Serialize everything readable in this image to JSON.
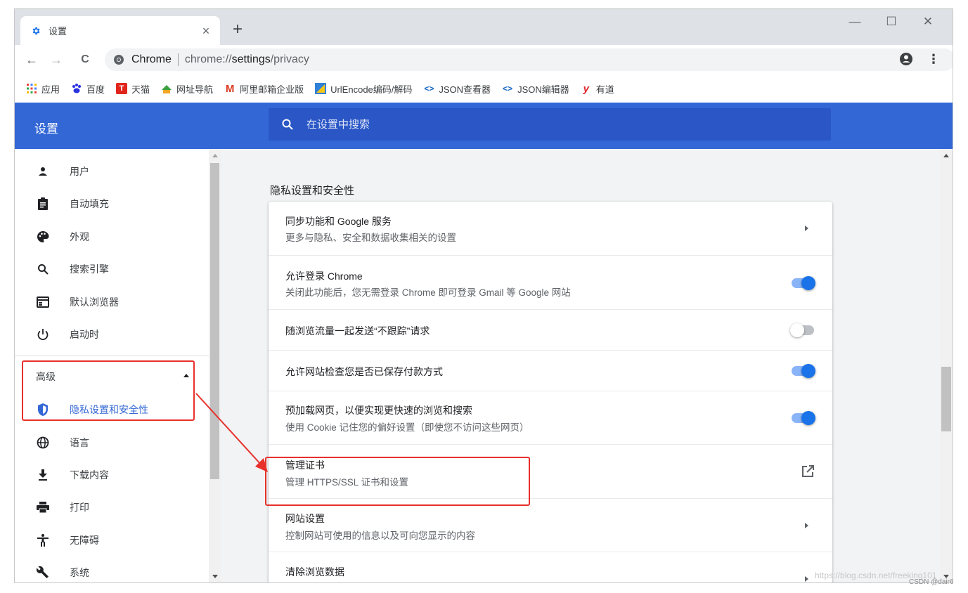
{
  "tab": {
    "icon": "gear-icon",
    "title": "设置",
    "close": "×"
  },
  "new_tab": "+",
  "window_controls": {
    "minimize": "—",
    "maximize": "☐",
    "close": "✕"
  },
  "toolbar": {
    "back": "←",
    "forward": "→",
    "reload": "C",
    "star": "☆",
    "menu": "⋮"
  },
  "omnibox": {
    "site_name": "Chrome",
    "url_prefix": "chrome://",
    "url_host": "settings",
    "url_path": "/privacy"
  },
  "bookmarks": [
    {
      "label": "应用",
      "icon": "apps-grid-icon",
      "color": "#1a73e8"
    },
    {
      "label": "百度",
      "icon": "baidu-paw-icon",
      "color": "#2932e1"
    },
    {
      "label": "天猫",
      "icon": "tmall-icon",
      "color": "#e1251b"
    },
    {
      "label": "网址导航",
      "icon": "hao123-icon",
      "color": "#3ba13f"
    },
    {
      "label": "阿里邮箱企业版",
      "icon": "ali-mail-icon",
      "color": "#d9381e"
    },
    {
      "label": "UrlEncode编码/解码",
      "icon": "urlencode-icon",
      "color": "#2f80d8"
    },
    {
      "label": "JSON查看器",
      "icon": "code-icon",
      "color": "#1565c0"
    },
    {
      "label": "JSON编辑器",
      "icon": "code-icon",
      "color": "#1565c0"
    },
    {
      "label": "有道",
      "icon": "youdao-icon",
      "color": "#e0272f"
    }
  ],
  "header": {
    "title": "设置",
    "search_placeholder": "在设置中搜索"
  },
  "sidebar": {
    "items": [
      {
        "label": "用户",
        "icon": "person-icon"
      },
      {
        "label": "自动填充",
        "icon": "clipboard-icon"
      },
      {
        "label": "外观",
        "icon": "palette-icon"
      },
      {
        "label": "搜索引擎",
        "icon": "search-icon"
      },
      {
        "label": "默认浏览器",
        "icon": "browser-icon"
      },
      {
        "label": "启动时",
        "icon": "power-icon"
      }
    ],
    "advanced_label": "高级",
    "advanced_items": [
      {
        "label": "隐私设置和安全性",
        "icon": "shield-icon",
        "active": true
      },
      {
        "label": "语言",
        "icon": "globe-icon"
      },
      {
        "label": "下载内容",
        "icon": "download-icon"
      },
      {
        "label": "打印",
        "icon": "printer-icon"
      },
      {
        "label": "无障碍",
        "icon": "accessibility-icon"
      },
      {
        "label": "系统",
        "icon": "wrench-icon"
      }
    ]
  },
  "main": {
    "section_title": "隐私设置和安全性",
    "rows": [
      {
        "title": "同步功能和 Google 服务",
        "subtitle": "更多与隐私、安全和数据收集相关的设置",
        "control": "chevron"
      },
      {
        "title": "允许登录 Chrome",
        "subtitle": "关闭此功能后，您无需登录 Chrome 即可登录 Gmail 等 Google 网站",
        "control": "toggle",
        "on": true
      },
      {
        "title": "随浏览流量一起发送“不跟踪”请求",
        "subtitle": "",
        "control": "toggle",
        "on": false
      },
      {
        "title": "允许网站检查您是否已保存付款方式",
        "subtitle": "",
        "control": "toggle",
        "on": true
      },
      {
        "title": "预加载网页，以便实现更快速的浏览和搜索",
        "subtitle": "使用 Cookie 记住您的偏好设置（即使您不访问这些网页）",
        "control": "toggle",
        "on": true
      },
      {
        "title": "管理证书",
        "subtitle": "管理 HTTPS/SSL 证书和设置",
        "control": "external"
      },
      {
        "title": "网站设置",
        "subtitle": "控制网站可使用的信息以及可向您显示的内容",
        "control": "chevron"
      },
      {
        "title": "清除浏览数据",
        "subtitle": "",
        "control": "chevron"
      }
    ]
  },
  "watermark": "https://blog.csdn.net/freeking101",
  "credit": "CSDN @dair6",
  "colors": {
    "header_blue": "#3367d6",
    "search_blue": "#2a56c6",
    "accent": "#1a73e8",
    "annotation_red": "#e8302b"
  }
}
